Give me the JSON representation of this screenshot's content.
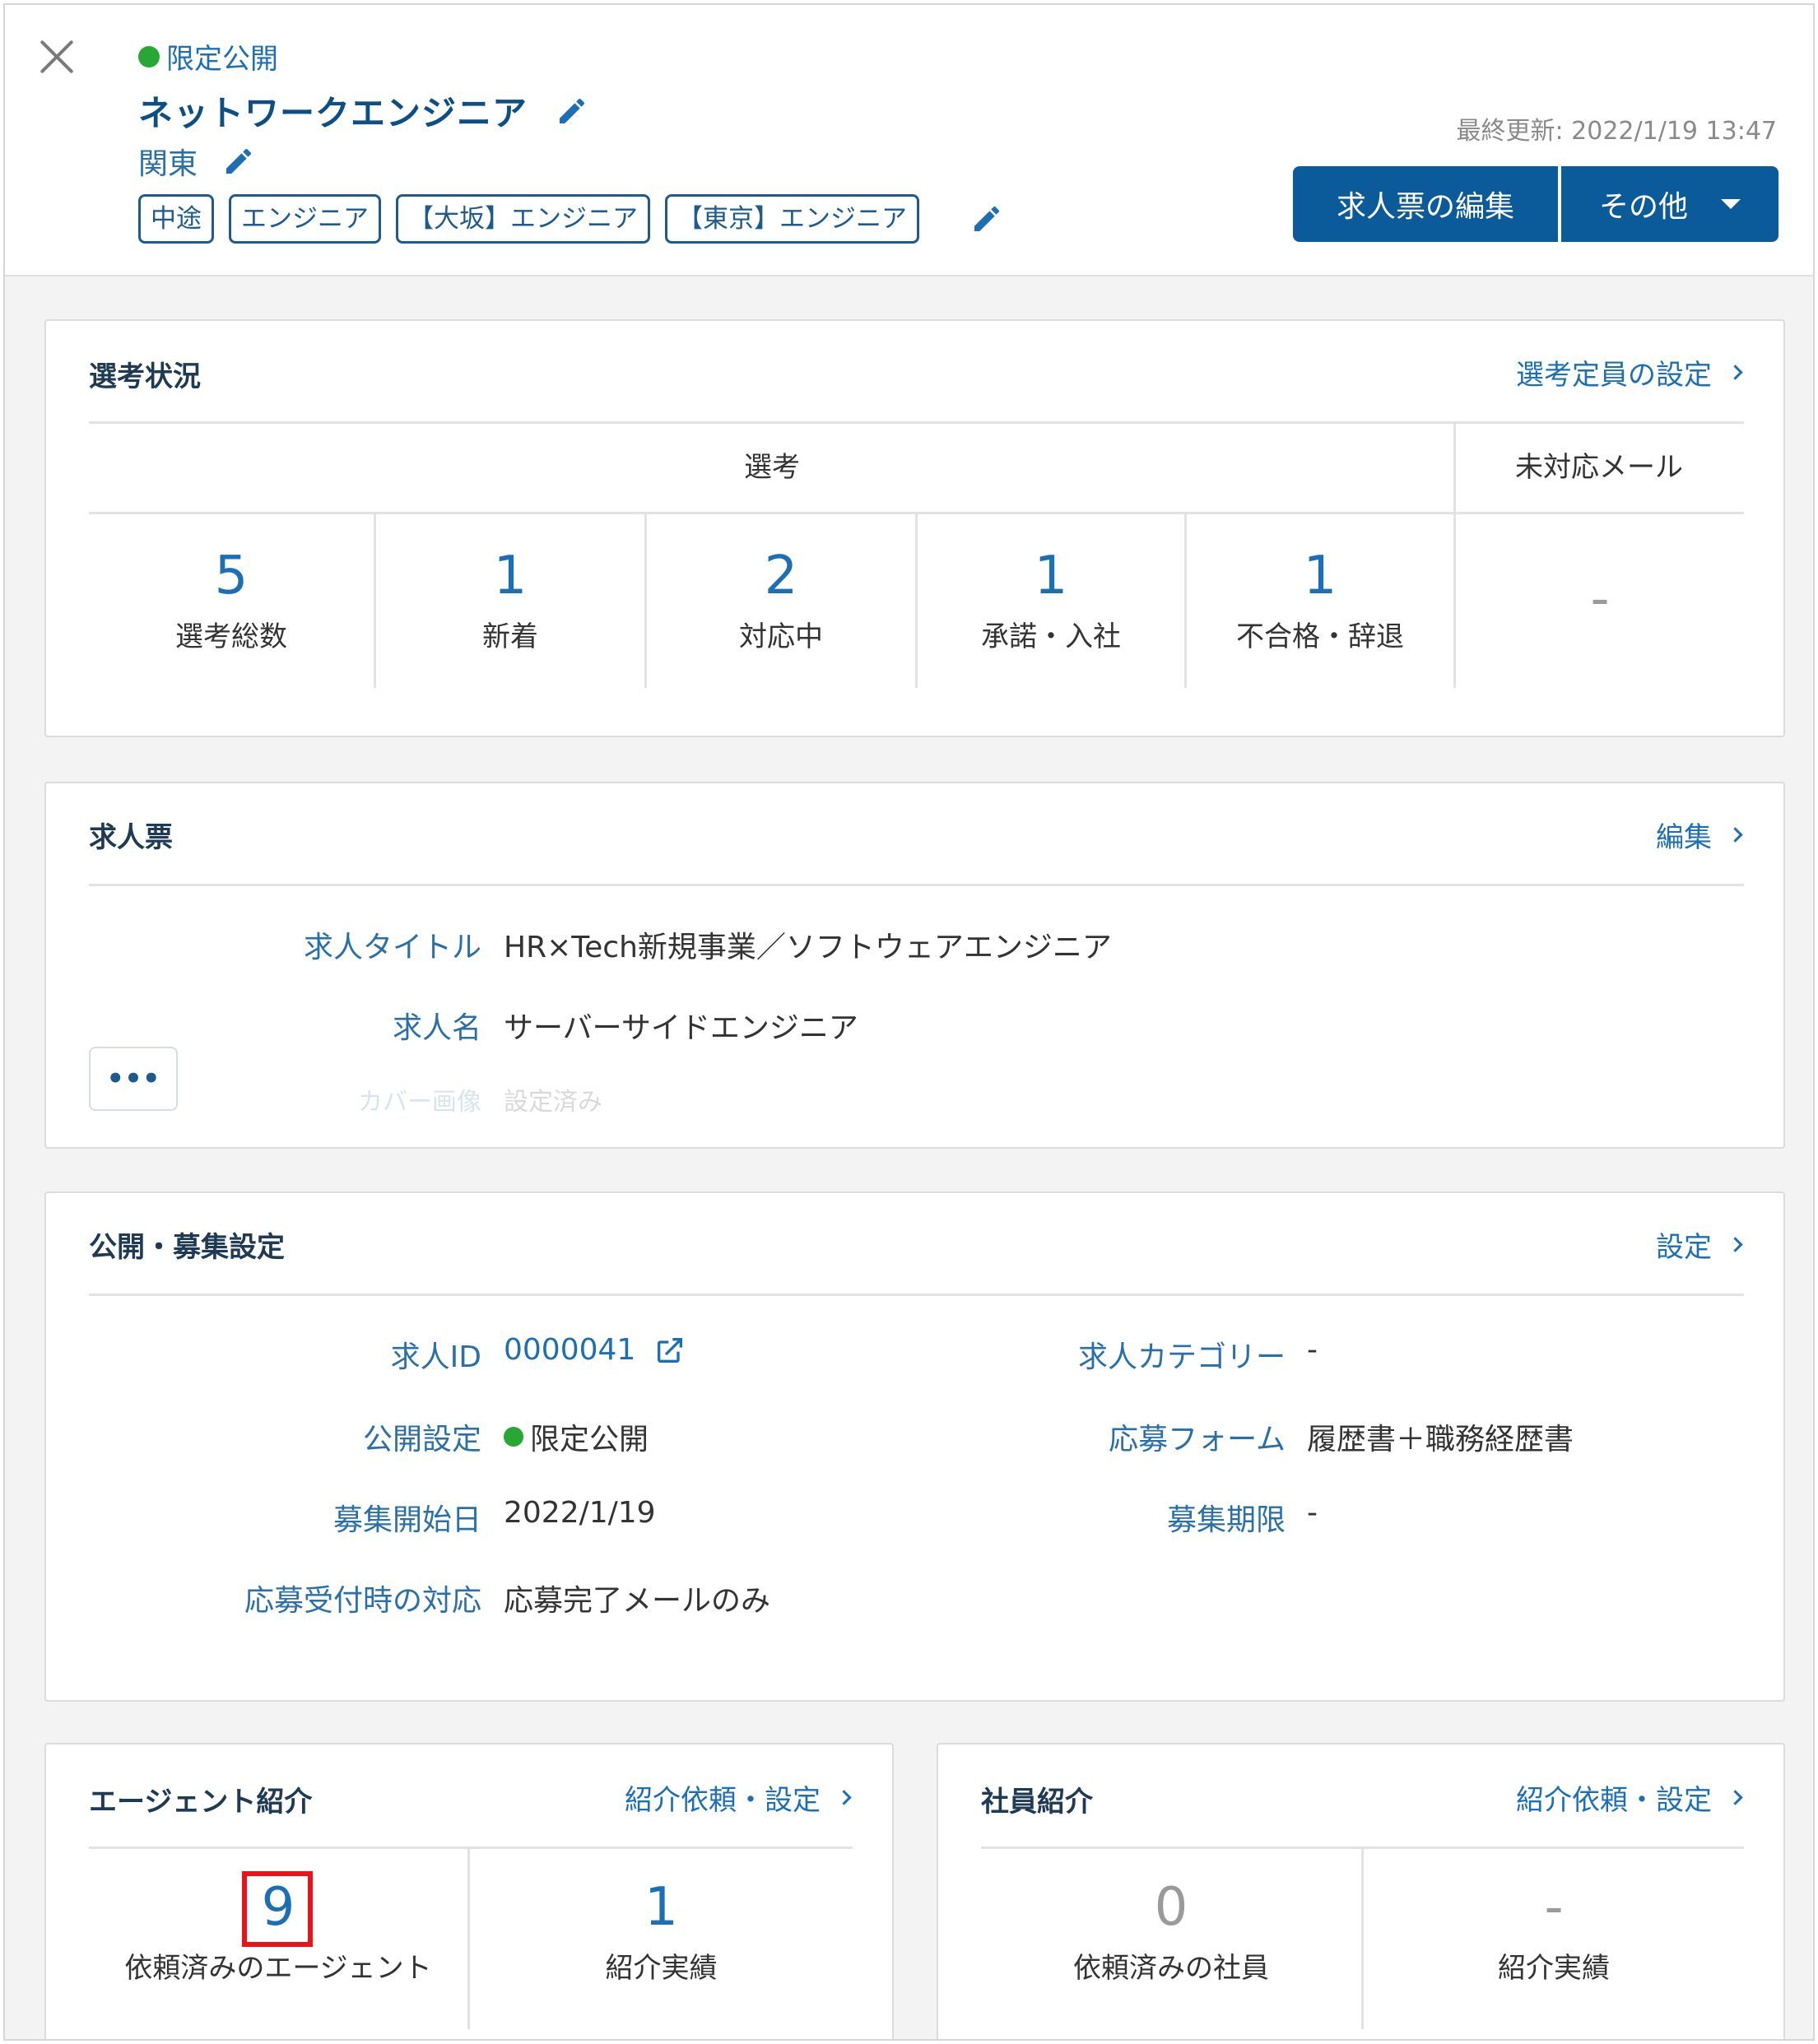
{
  "header": {
    "status": "限定公開",
    "job_title": "ネットワークエンジニア",
    "region": "関東",
    "tags": [
      "中途",
      "エンジニア",
      "【大坂】エンジニア",
      "【東京】エンジニア"
    ],
    "last_updated": "最終更新: 2022/1/19 13:47",
    "edit_button": "求人票の編集",
    "more_button": "その他"
  },
  "selection": {
    "title": "選考状況",
    "link": "選考定員の設定",
    "col_selection": "選考",
    "col_mail": "未対応メール",
    "stats": [
      {
        "value": "5",
        "label": "選考総数"
      },
      {
        "value": "1",
        "label": "新着"
      },
      {
        "value": "2",
        "label": "対応中"
      },
      {
        "value": "1",
        "label": "承諾・入社"
      },
      {
        "value": "1",
        "label": "不合格・辞退"
      }
    ],
    "mail_value": "-"
  },
  "job_sheet": {
    "title": "求人票",
    "link": "編集",
    "rows": [
      {
        "label": "求人タイトル",
        "value": "HR×Tech新規事業／ソフトウェアエンジニア"
      },
      {
        "label": "求人名",
        "value": "サーバーサイドエンジニア"
      },
      {
        "label": "カバー画像",
        "value": "設定済み"
      }
    ],
    "more_label": "•••"
  },
  "publish": {
    "title": "公開・募集設定",
    "link": "設定",
    "job_id_label": "求人ID",
    "job_id_value": "0000041",
    "visibility_label": "公開設定",
    "visibility_value": "限定公開",
    "start_label": "募集開始日",
    "start_value": "2022/1/19",
    "response_label": "応募受付時の対応",
    "response_value": "応募完了メールのみ",
    "category_label": "求人カテゴリー",
    "category_value": "-",
    "form_label": "応募フォーム",
    "form_value": "履歴書＋職務経歴書",
    "deadline_label": "募集期限",
    "deadline_value": "-"
  },
  "agent": {
    "title": "エージェント紹介",
    "link": "紹介依頼・設定",
    "requested_value": "9",
    "requested_label": "依頼済みのエージェント",
    "result_value": "1",
    "result_label": "紹介実績"
  },
  "employee": {
    "title": "社員紹介",
    "link": "紹介依頼・設定",
    "requested_value": "0",
    "requested_label": "依頼済みの社員",
    "result_value": "-",
    "result_label": "紹介実績"
  },
  "colors": {
    "primary": "#0b5a99",
    "link": "#1d6fb5",
    "status_green": "#27a834",
    "highlight_red": "#e8141b"
  }
}
